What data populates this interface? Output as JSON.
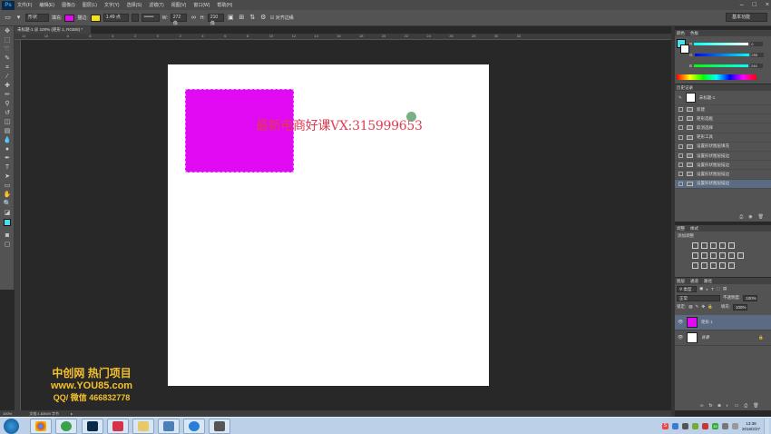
{
  "app": {
    "logo": "Ps",
    "menu": [
      "文件(F)",
      "编辑(E)",
      "图像(I)",
      "图层(L)",
      "文字(Y)",
      "选择(S)",
      "滤镜(T)",
      "视图(V)",
      "窗口(W)",
      "帮助(H)"
    ],
    "window_controls": [
      "–",
      "□",
      "×"
    ]
  },
  "options_bar": {
    "shape_mode": "形状",
    "fill_label": "填充:",
    "fill_color": "#e20af2",
    "stroke_label": "描边:",
    "stroke_color": "#f5e316",
    "stroke_width": "1.49 点",
    "w_label": "W:",
    "w_value": "272 像",
    "h_label": "H:",
    "h_value": "210 像",
    "align_edges": "对齐边缘",
    "workspace": "基本功能"
  },
  "document": {
    "tab_title": "未标题-1 @ 100% (矩形 1, RGB/8) *",
    "ruler_ticks": [
      "12",
      "10",
      "8",
      "6",
      "4",
      "2",
      "0",
      "2",
      "4",
      "6",
      "8",
      "10",
      "12",
      "14",
      "16",
      "18",
      "20",
      "22",
      "24",
      "26",
      "28",
      "30",
      "32"
    ],
    "watermark": "最新电商好课VX:315999653",
    "promo_line1": "中创网 热门项目",
    "promo_line2": "www.YOU85.com",
    "promo_line3": "QQ/ 微信 466832778",
    "zoom": "100%",
    "doc_info": "文档:1.83M/0 字节"
  },
  "color_panel": {
    "tabs": [
      "颜色",
      "色板"
    ],
    "foreground": "#45e0ee",
    "r_label": "R",
    "r_value": "0",
    "g_label": "G",
    "g_value": "255",
    "b_label": "B",
    "b_value": "246"
  },
  "history_panel": {
    "tabs": [
      "历史记录"
    ],
    "snapshot": "未标题-1",
    "items": [
      "新建",
      "矩形选框",
      "取消选择",
      "矩形工具",
      "设置形状图层填充",
      "设置形状图层描边",
      "设置形状图层描边",
      "设置形状图层描边",
      "设置形状图层描边"
    ]
  },
  "adjustments_panel": {
    "tabs": [
      "调整",
      "样式"
    ],
    "heading": "添加调整"
  },
  "layers_panel": {
    "tabs": [
      "图层",
      "通道",
      "路径"
    ],
    "filter": "类型",
    "blend_mode": "正常",
    "opacity_label": "不透明度:",
    "opacity_value": "100%",
    "lock_label": "锁定:",
    "fill_label": "填充:",
    "fill_value": "100%",
    "layers": [
      {
        "name": "矩形 1",
        "color": "#e20af2"
      },
      {
        "name": "背景",
        "color": "#ffffff"
      }
    ]
  },
  "taskbar": {
    "time": "13:38",
    "date": "2018/2/27",
    "input_badge": "S",
    "tray_number": "39"
  }
}
